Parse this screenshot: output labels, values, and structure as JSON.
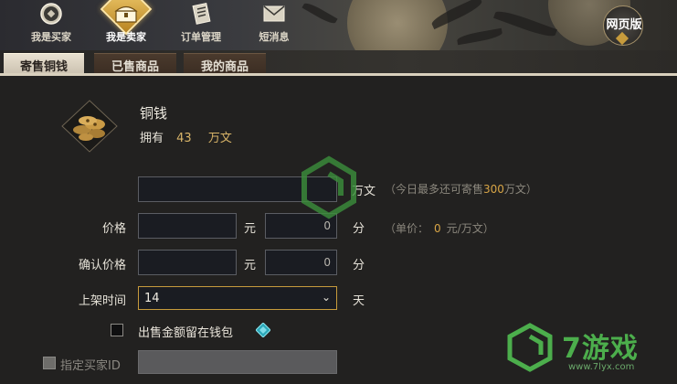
{
  "nav": {
    "items": [
      {
        "label": "我是买家",
        "icon": "coin-icon"
      },
      {
        "label": "我是卖家",
        "icon": "treasure-chest-icon"
      },
      {
        "label": "订单管理",
        "icon": "scroll-icon"
      },
      {
        "label": "短消息",
        "icon": "envelope-icon"
      }
    ],
    "active_index": 1,
    "web_label": "网页版"
  },
  "tabs": [
    {
      "label": "寄售铜钱",
      "active": true
    },
    {
      "label": "已售商品",
      "active": false
    },
    {
      "label": "我的商品",
      "active": false
    }
  ],
  "item": {
    "name": "铜钱",
    "own_label": "拥有",
    "own_value": "43",
    "own_unit": "万文",
    "icon": "copper-coins-icon"
  },
  "form": {
    "amount": {
      "value": "",
      "unit": "万文",
      "hint_prefix": "（今日最多还可寄售",
      "hint_value": "300",
      "hint_suffix": "万文）"
    },
    "price": {
      "label": "价格",
      "yuan_value": "",
      "yuan_unit": "元",
      "fen_value": "0",
      "fen_unit": "分",
      "hint_prefix": "（单价：",
      "hint_value": "0",
      "hint_suffix": "元/万文）"
    },
    "confirm_price": {
      "label": "确认价格",
      "yuan_value": "",
      "yuan_unit": "元",
      "fen_value": "0",
      "fen_unit": "分"
    },
    "listing_time": {
      "label": "上架时间",
      "value": "14",
      "unit": "天"
    },
    "keep_in_wallet": {
      "label": "出售金额留在钱包",
      "checked": false
    },
    "specify_buyer": {
      "label": "指定买家ID",
      "value": "",
      "enabled": false
    }
  },
  "watermark": {
    "brand": "7游戏",
    "url": "www.7lyx.com"
  },
  "colors": {
    "accent_gold": "#d8a546",
    "highlight": "#d8b468",
    "watermark_green": "#4cae4c"
  }
}
